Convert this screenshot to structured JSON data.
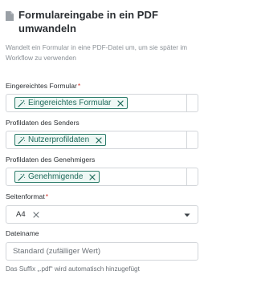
{
  "header": {
    "title": "Formulareingabe in ein PDF umwandeln",
    "description": "Wandelt ein Formular in eine PDF-Datei um, um sie später im Workflow zu verwenden",
    "icon": "document-icon"
  },
  "fields": {
    "submitted_form": {
      "label": "Eingereichtes Formular",
      "required_marker": "*",
      "chip": "Eingereichtes Formular"
    },
    "sender_profile": {
      "label": "Profildaten des Senders",
      "chip": "Nutzerprofildaten"
    },
    "approver_profile": {
      "label": "Profildaten des Genehmigers",
      "chip": "Genehmigende"
    },
    "page_format": {
      "label": "Seitenformat",
      "required_marker": "*",
      "value": "A4"
    },
    "file_name": {
      "label": "Dateiname",
      "placeholder": "Standard (zufälliger Wert)",
      "hint": "Das Suffix „.pdf“ wird automatisch hinzugefügt"
    }
  },
  "colors": {
    "chip_border": "#2e7d6b",
    "chip_text": "#1f6b5b",
    "chip_bg": "#eef8f5",
    "required": "#d0342c"
  }
}
